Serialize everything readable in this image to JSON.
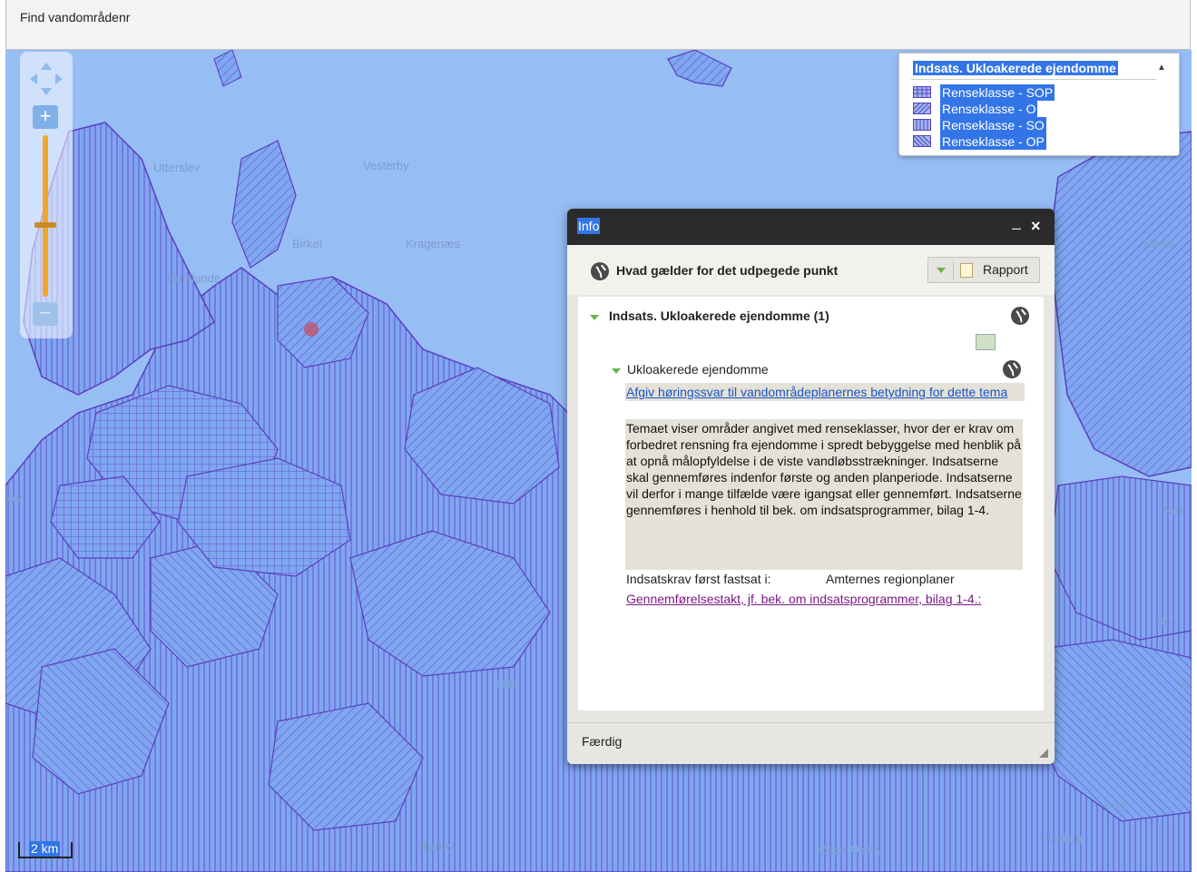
{
  "topbar": {
    "search_label": "Find vandområdenr"
  },
  "map": {
    "places": {
      "utterslev": "Utterslev",
      "vesterby": "Vesterby",
      "birket": "Birket",
      "kragenaes": "Kragenæs",
      "horslunde": "Horslunde",
      "norre": "Nørre",
      "nor": "Nor",
      "sun": "Sun",
      "ov": "ov",
      "hille": "Hille",
      "rodby": "Rødby",
      "oster_ulslev": "Øster Ulslev",
      "frej": "Frej",
      "ketting": "Ketting",
      "n": "N"
    },
    "colors": {
      "water": "#97bdf5",
      "land": "#7ea7ef",
      "hatch": "#6a4fd0",
      "marker": "#c94a5e"
    }
  },
  "zoom": {
    "in_label": "+",
    "out_label": "−"
  },
  "legend": {
    "title": "Indsats. Ukloakerede ejendomme",
    "scroll_up_icon": "▲",
    "items": [
      {
        "label": "Renseklasse - SOP",
        "pattern": "grid"
      },
      {
        "label": "Renseklasse - O",
        "pattern": "diag-right"
      },
      {
        "label": "Renseklasse - SO",
        "pattern": "vertical"
      },
      {
        "label": "Renseklasse - OP",
        "pattern": "diag-left"
      }
    ]
  },
  "info": {
    "title": "Info",
    "minimize_icon": "–",
    "close_icon": "×",
    "heading": "Hvad gælder for det udpegede punkt",
    "rapport_label": "Rapport",
    "layer_heading": "Indsats. Ukloakerede ejendomme (1)",
    "sublayer_heading": "Ukloakerede ejendomme",
    "hearing_link": "Afgiv høringssvar til vandområdeplanernes betydning for dette tema",
    "description": "Temaet viser områder angivet med renseklasser, hvor der er krav om forbedret rensning fra ejendomme i spredt bebyggelse med henblik på at opnå målopfyldelse i de viste vandløbsstrækninger. Indsatserne skal gennemføres indenfor første og anden planperiode. Indsatserne vil derfor i mange tilfælde være igangsat eller gennemført. Indsatserne gennemføres i henhold til bek. om indsatsprogrammer, bilag 1-4.",
    "fact_label": "Indsatskrav først fastsat i:",
    "fact_value": "Amternes regionplaner",
    "implementation_link": "Gennemførelsestakt, jf. bek. om indsatsprogrammer, bilag 1-4.:",
    "status": "Færdig"
  },
  "scale": {
    "label": "2 km"
  }
}
